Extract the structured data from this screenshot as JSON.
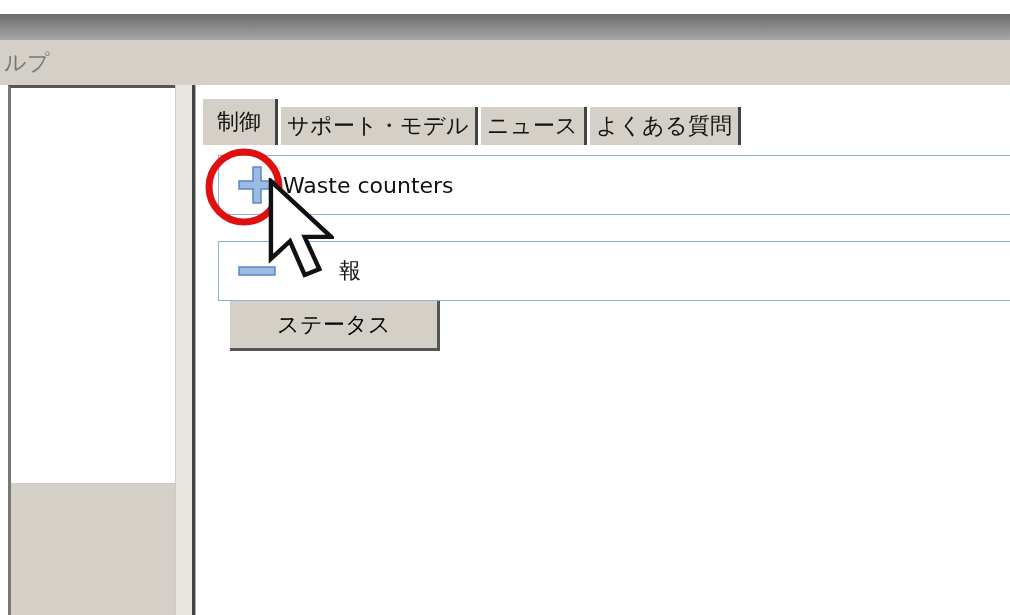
{
  "menu_bar": {
    "items": [
      "ルプ"
    ]
  },
  "tabs": [
    {
      "label": "制御",
      "selected": true
    },
    {
      "label": "サポート・モデル",
      "selected": false
    },
    {
      "label": "ニュース",
      "selected": false
    },
    {
      "label": "よくある質問",
      "selected": false
    }
  ],
  "sections": [
    {
      "title": "Waste counters",
      "expanded": false
    },
    {
      "title": "報",
      "expanded": true
    }
  ],
  "buttons": [
    "ステータス"
  ]
}
